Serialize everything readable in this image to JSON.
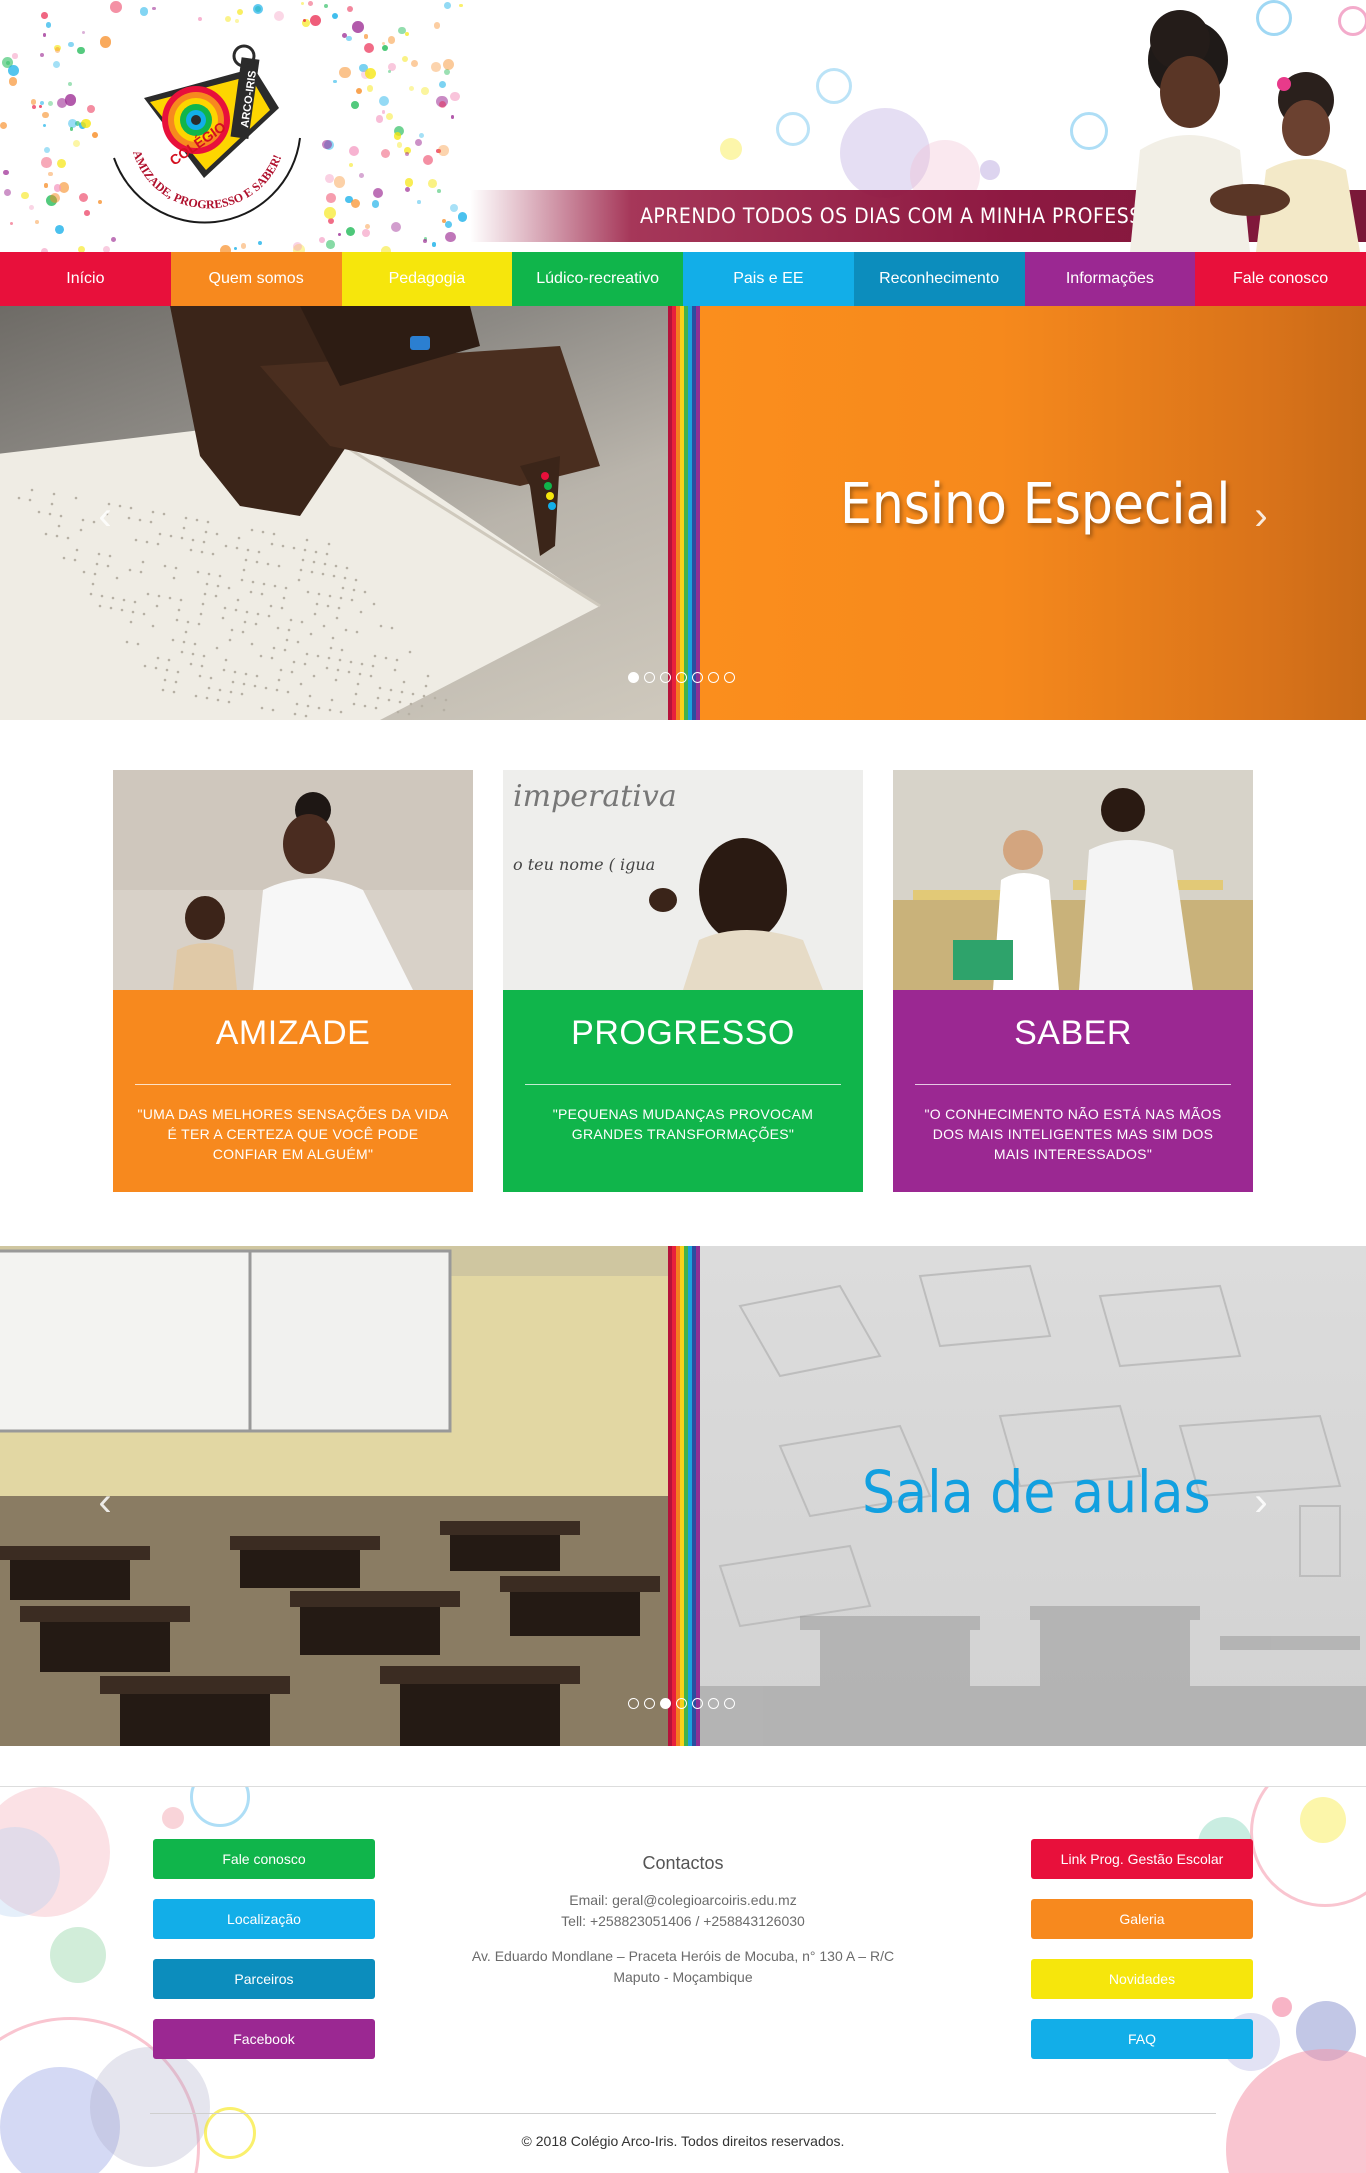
{
  "header": {
    "logo": {
      "school_name": "COLÉGIO",
      "brand": "ARCO-IRIS",
      "motto": "AMIZADE, PROGRESSO E SABER!"
    },
    "tagline": "APRENDO TODOS OS DIAS COM A MINHA PROFESSORA."
  },
  "nav": {
    "items": [
      {
        "label": "Início",
        "color": "#e8103b"
      },
      {
        "label": "Quem somos",
        "color": "#f7891e"
      },
      {
        "label": "Pedagogia",
        "color": "#f6e60c"
      },
      {
        "label": "Lúdico-recreativo",
        "color": "#10b54b"
      },
      {
        "label": "Pais e EE",
        "color": "#12aee8"
      },
      {
        "label": "Reconhecimento",
        "color": "#0c8dbd"
      },
      {
        "label": "Informações",
        "color": "#9b2892"
      },
      {
        "label": "Fale conosco",
        "color": "#e8103b"
      }
    ]
  },
  "slider1": {
    "title": "Ensino Especial",
    "prev_icon": "chevron-left-icon",
    "next_icon": "chevron-right-icon",
    "dot_count": 7,
    "active_dot": 1
  },
  "cards": [
    {
      "title": "AMIZADE",
      "quote": "\"UMA DAS MELHORES SENSAÇÕES DA VIDA É TER A CERTEZA QUE VOCÊ PODE CONFIAR EM ALGUÉM\"",
      "color": "#f7891e"
    },
    {
      "title": "PROGRESSO",
      "quote": "\"PEQUENAS MUDANÇAS PROVOCAM GRANDES TRANSFORMAÇÕES\"",
      "color": "#10b54b"
    },
    {
      "title": "SABER",
      "quote": "\"O CONHECIMENTO NÃO ESTÁ NAS MÃOS DOS MAIS INTELIGENTES MAS SIM DOS MAIS INTERESSADOS\"",
      "color": "#9b2892"
    }
  ],
  "slider2": {
    "title": "Sala de aulas",
    "prev_icon": "chevron-left-icon",
    "next_icon": "chevron-right-icon",
    "dot_count": 7,
    "active_dot": 3
  },
  "footer": {
    "left_buttons": [
      {
        "label": "Fale conosco",
        "color": "#10b54b"
      },
      {
        "label": "Localização",
        "color": "#12aee8"
      },
      {
        "label": "Parceiros",
        "color": "#0c8dbd"
      },
      {
        "label": "Facebook",
        "color": "#9b2892"
      }
    ],
    "contacts": {
      "title": "Contactos",
      "email": "Email:  geral@colegioarcoiris.edu.mz",
      "tel": "Tell:  +258823051406 /  +258843126030",
      "address_line1": "Av. Eduardo Mondlane – Praceta Heróis de Mocuba, n° 130 A – R/C",
      "address_line2": "Maputo - Moçambique"
    },
    "right_buttons": [
      {
        "label": "Link Prog. Gestão Escolar",
        "color": "#e8103b"
      },
      {
        "label": "Galeria",
        "color": "#f7891e"
      },
      {
        "label": "Novidades",
        "color": "#f6e60c"
      },
      {
        "label": "FAQ",
        "color": "#12aee8"
      }
    ],
    "copyright": "© 2018 Colégio Arco-Iris. Todos direitos reservados."
  }
}
